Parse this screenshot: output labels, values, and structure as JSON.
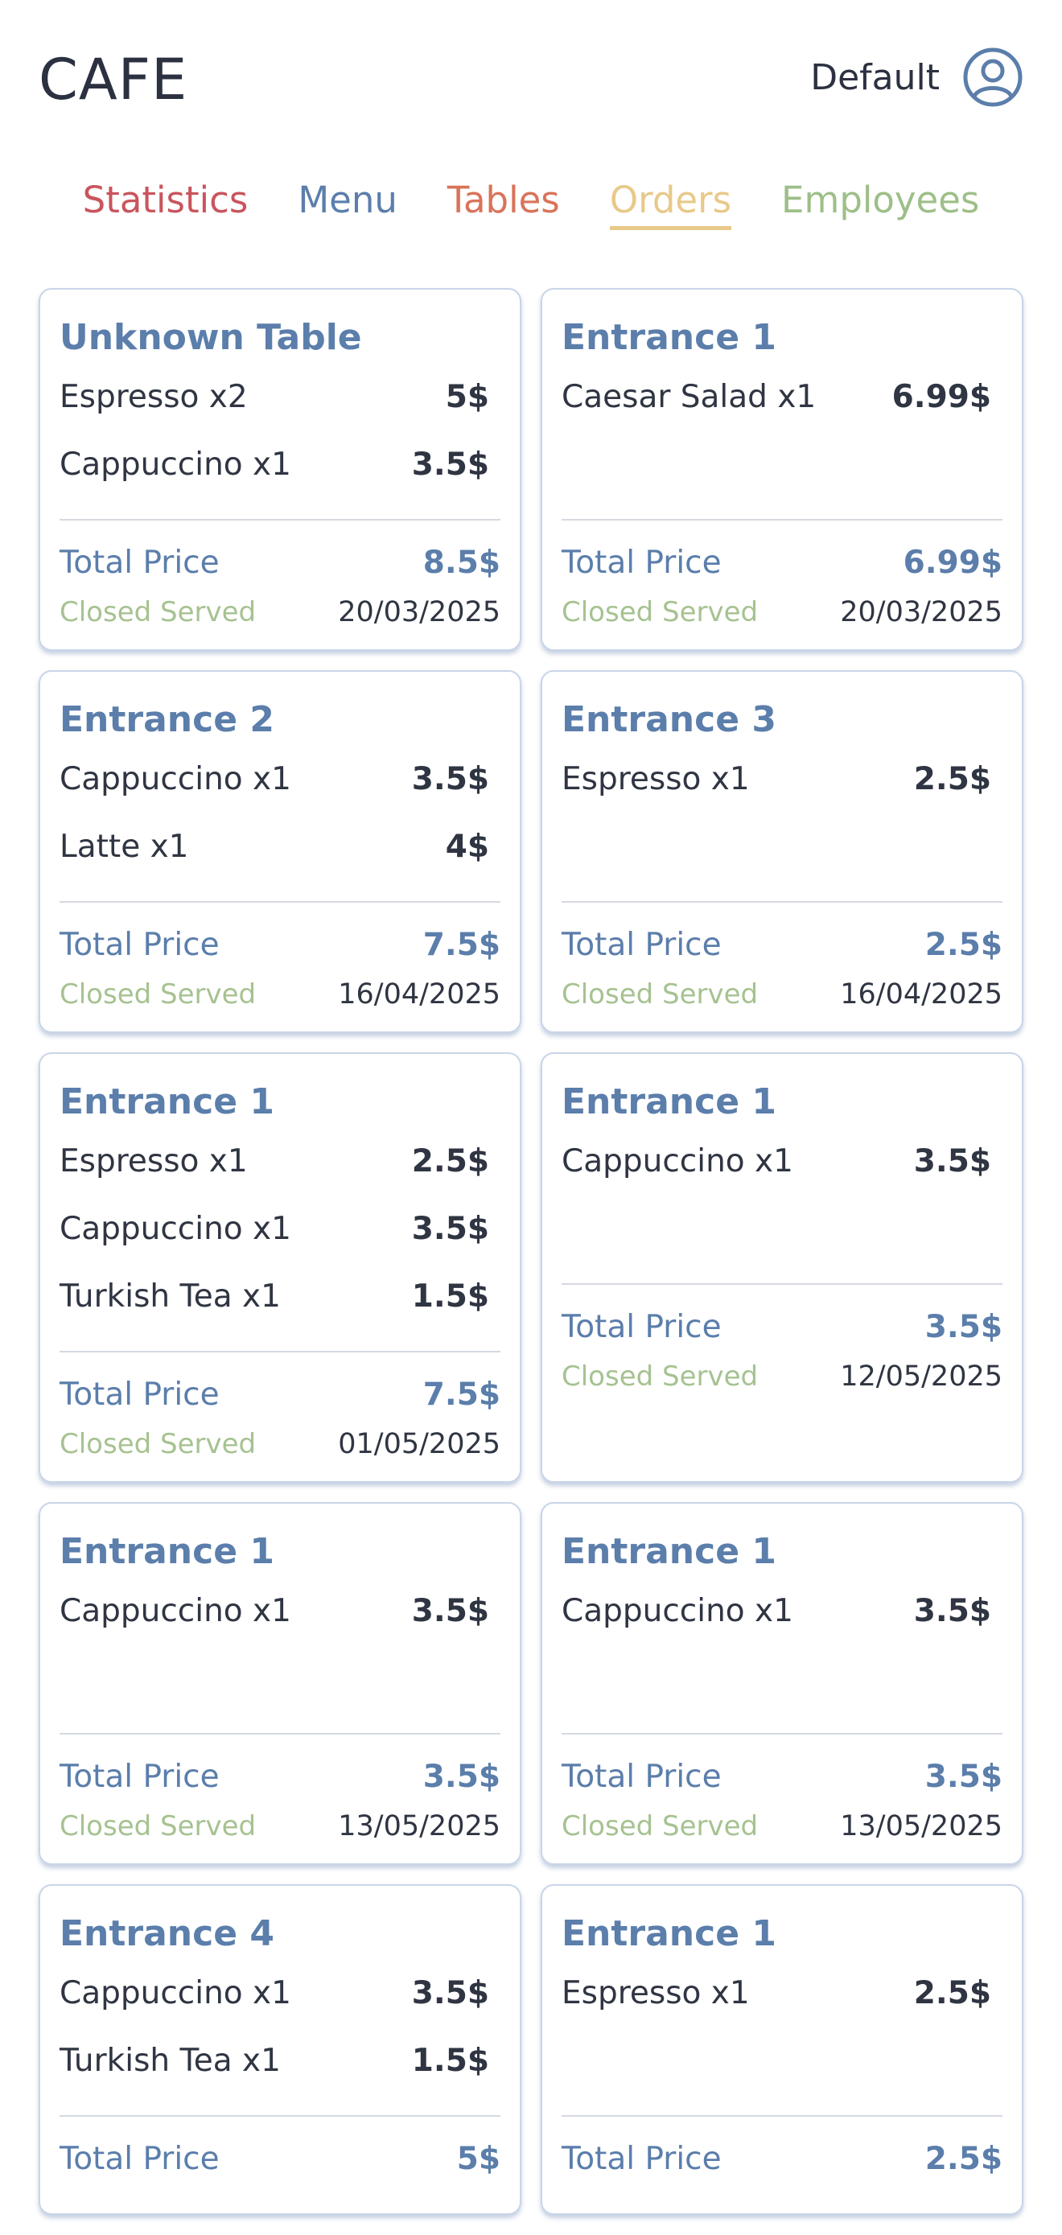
{
  "header": {
    "brand": "CAFE",
    "user_name": "Default",
    "user_icon": "user-circle-icon"
  },
  "nav": {
    "tabs": [
      {
        "label": "Statistics",
        "color": "#c9555d"
      },
      {
        "label": "Menu",
        "color": "#5b7eab"
      },
      {
        "label": "Tables",
        "color": "#d9735a"
      },
      {
        "label": "Orders",
        "color": "#e8c98a",
        "active": true
      },
      {
        "label": "Employees",
        "color": "#9dbf88"
      }
    ]
  },
  "colors": {
    "accent_blue": "#5b7eab",
    "status_green": "#a6c291",
    "text_dark": "#2f3542"
  },
  "orders": [
    {
      "table": "Unknown Table",
      "items": [
        {
          "name": "Espresso x2",
          "price": "5$"
        },
        {
          "name": "Cappuccino x1",
          "price": "3.5$"
        }
      ],
      "total_label": "Total Price",
      "total": "8.5$",
      "status": "Closed Served",
      "date": "20/03/2025"
    },
    {
      "table": "Entrance 1",
      "items": [
        {
          "name": "Caesar Salad x1",
          "price": "6.99$"
        }
      ],
      "total_label": "Total Price",
      "total": "6.99$",
      "status": "Closed Served",
      "date": "20/03/2025"
    },
    {
      "table": "Entrance 2",
      "items": [
        {
          "name": "Cappuccino x1",
          "price": "3.5$"
        },
        {
          "name": "Latte x1",
          "price": "4$"
        }
      ],
      "total_label": "Total Price",
      "total": "7.5$",
      "status": "Closed Served",
      "date": "16/04/2025"
    },
    {
      "table": "Entrance 3",
      "items": [
        {
          "name": "Espresso x1",
          "price": "2.5$"
        }
      ],
      "total_label": "Total Price",
      "total": "2.5$",
      "status": "Closed Served",
      "date": "16/04/2025"
    },
    {
      "table": "Entrance 1",
      "items": [
        {
          "name": "Espresso x1",
          "price": "2.5$"
        },
        {
          "name": "Cappuccino x1",
          "price": "3.5$"
        },
        {
          "name": "Turkish Tea x1",
          "price": "1.5$"
        }
      ],
      "total_label": "Total Price",
      "total": "7.5$",
      "status": "Closed Served",
      "date": "01/05/2025"
    },
    {
      "table": "Entrance 1",
      "items": [
        {
          "name": "Cappuccino x1",
          "price": "3.5$"
        }
      ],
      "total_label": "Total Price",
      "total": "3.5$",
      "status": "Closed Served",
      "date": "12/05/2025"
    },
    {
      "table": "Entrance 1",
      "items": [
        {
          "name": "Cappuccino x1",
          "price": "3.5$"
        }
      ],
      "total_label": "Total Price",
      "total": "3.5$",
      "status": "Closed Served",
      "date": "13/05/2025"
    },
    {
      "table": "Entrance 1",
      "items": [
        {
          "name": "Cappuccino x1",
          "price": "3.5$"
        }
      ],
      "total_label": "Total Price",
      "total": "3.5$",
      "status": "Closed Served",
      "date": "13/05/2025"
    },
    {
      "table": "Entrance 4",
      "items": [
        {
          "name": "Cappuccino x1",
          "price": "3.5$"
        },
        {
          "name": "Turkish Tea x1",
          "price": "1.5$"
        }
      ],
      "total_label": "Total Price",
      "total": "5$",
      "status": "",
      "date": ""
    },
    {
      "table": "Entrance 1",
      "items": [
        {
          "name": "Espresso x1",
          "price": "2.5$"
        }
      ],
      "total_label": "Total Price",
      "total": "2.5$",
      "status": "",
      "date": ""
    }
  ]
}
